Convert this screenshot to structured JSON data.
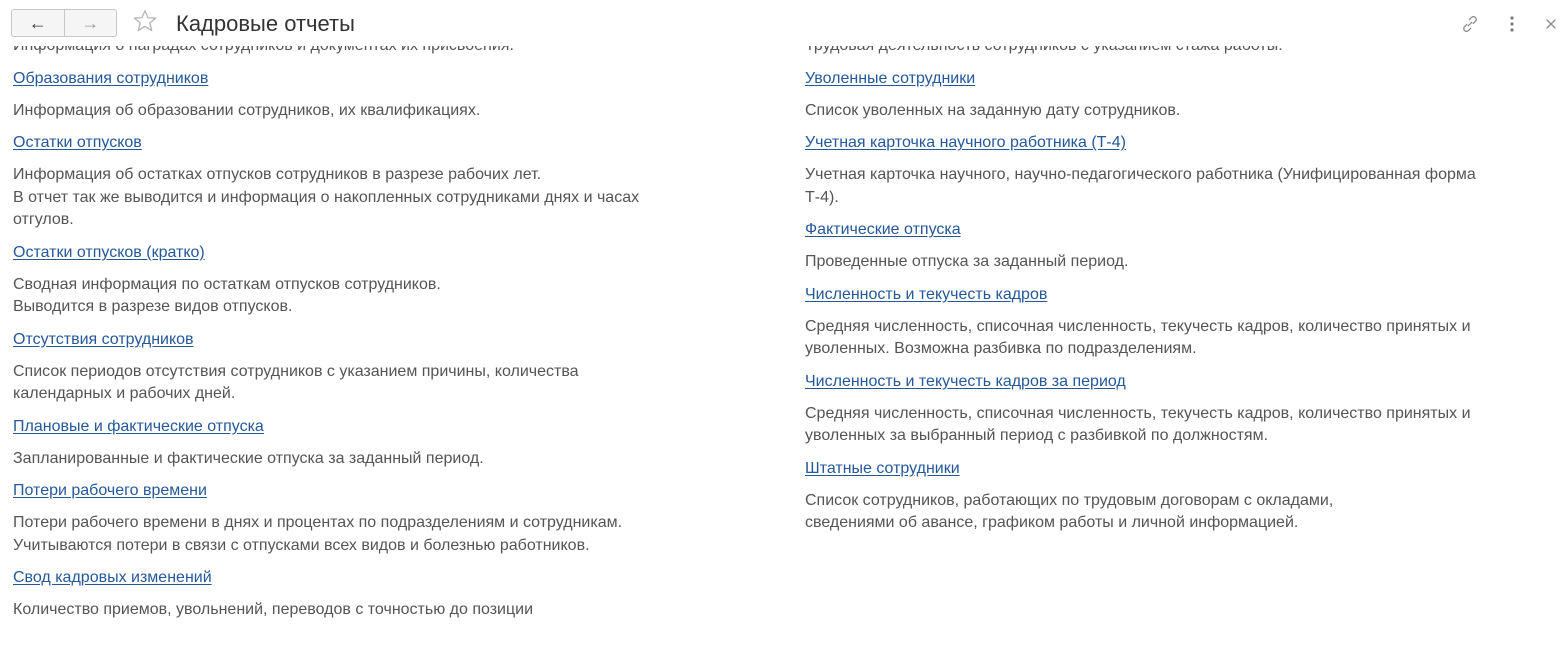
{
  "window": {
    "title": "Кадровые отчеты",
    "icons": [
      "back-arrow-icon",
      "forward-arrow-icon",
      "star-icon",
      "link-icon",
      "more-icon",
      "close-icon"
    ]
  },
  "left_column": [
    {
      "title": "",
      "description": "Информация о наградах сотрудников и документах их присвоения."
    },
    {
      "title": "Образования сотрудников",
      "description": "Информация об образовании сотрудников, их квалификациях."
    },
    {
      "title": "Остатки отпусков",
      "description": "Информация об остатках отпусков сотрудников в разрезе рабочих лет.\nВ отчет так же выводится и информация о накопленных сотрудниками днях и часах\nотгулов."
    },
    {
      "title": "Остатки отпусков (кратко)",
      "description": "Сводная информация по остаткам отпусков сотрудников.\nВыводится в разрезе видов отпусков."
    },
    {
      "title": "Отсутствия сотрудников",
      "description": "Список периодов отсутствия сотрудников с указанием причины, количества\nкалендарных и рабочих дней."
    },
    {
      "title": "Плановые и фактические отпуска",
      "description": "Запланированные и фактические отпуска за заданный период."
    },
    {
      "title": "Потери рабочего времени",
      "description": "Потери рабочего времени в днях и процентах по подразделениям и сотрудникам.\nУчитываются потери в связи с отпусками всех видов и болезнью работников."
    },
    {
      "title": "Свод кадровых изменений",
      "description": "Количество приемов, увольнений, переводов с точностью до позиции"
    }
  ],
  "right_column": [
    {
      "title": "",
      "description": "Трудовая деятельность сотрудников с указанием стажа работы."
    },
    {
      "title": "Уволенные сотрудники",
      "description": "Список уволенных на заданную дату сотрудников."
    },
    {
      "title": "Учетная карточка научного работника (Т-4)",
      "description": "Учетная карточка научного, научно-педагогического работника (Унифицированная форма\nТ-4)."
    },
    {
      "title": "Фактические отпуска",
      "description": "Проведенные отпуска за заданный период."
    },
    {
      "title": "Численность и текучесть кадров",
      "description": "Средняя численность, списочная численность, текучесть кадров, количество принятых и\nуволенных. Возможна разбивка по подразделениям."
    },
    {
      "title": "Численность и текучесть кадров за период",
      "description": "Средняя численность, списочная численность, текучесть кадров, количество принятых и\nуволенных за выбранный период с разбивкой по должностям."
    },
    {
      "title": "Штатные сотрудники",
      "description": "Список сотрудников, работающих по трудовым договорам с окладами,\nсведениями об авансе, графиком работы и личной информацией."
    }
  ]
}
